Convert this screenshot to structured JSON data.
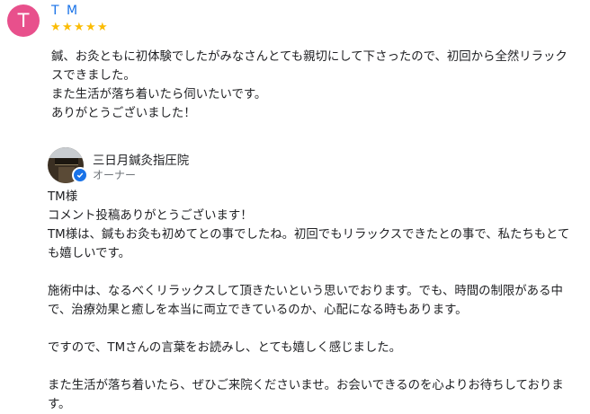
{
  "colors": {
    "avatar_bg": "#e8508c",
    "star": "#fbbc04",
    "name": "#1a73e8",
    "verified": "#1a73e8"
  },
  "review": {
    "avatar_letter": "T",
    "reviewer_name": "T M",
    "rating": 5,
    "star_glyph": "★",
    "text": "鍼、お灸ともに初体験でしたがみなさんとても親切にして下さったので、初回から全然リラックスできました。\nまた生活が落ち着いたら伺いたいです。\nありがとうございました！"
  },
  "owner": {
    "avatar_icon": "storefront-photo-icon",
    "verified_icon": "verified-check-icon",
    "name": "三日月鍼灸指圧院",
    "role": "オーナー",
    "reply": "TM様\nコメント投稿ありがとうございます！\nTM様は、鍼もお灸も初めてとの事でしたね。初回でもリラックスできたとの事で、私たちもとても嬉しいです。\n\n施術中は、なるべくリラックスして頂きたいという思いでおります。でも、時間の制限がある中で、治療効果と癒しを本当に両立できているのか、心配になる時もあります。\n\nですので、TMさんの言葉をお読みし、とても嬉しく感じました。\n\nまた生活が落ち着いたら、ぜひご来院くださいませ。お会いできるのを心よりお待ちしております。"
  }
}
